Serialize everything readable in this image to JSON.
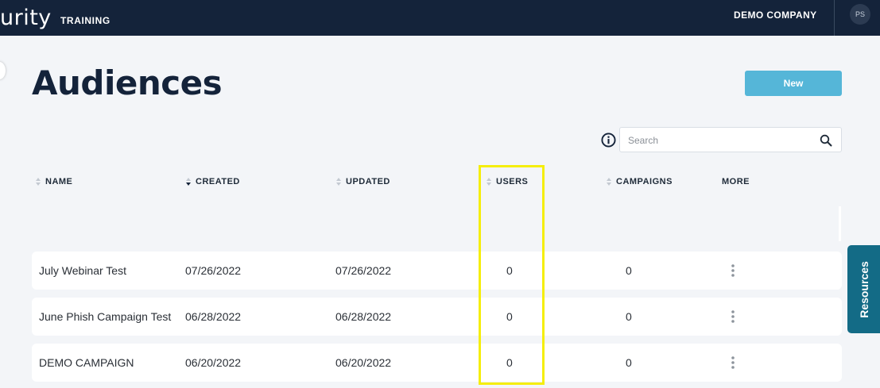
{
  "topbar": {
    "logo_text": "urity",
    "product": "TRAINING",
    "company": "DEMO COMPANY",
    "avatar_initials": "PS"
  },
  "page": {
    "title": "Audiences",
    "new_label": "New"
  },
  "search": {
    "placeholder": "Search",
    "value": ""
  },
  "columns": {
    "name": "NAME",
    "created": "CREATED",
    "updated": "UPDATED",
    "users": "USERS",
    "campaigns": "CAMPAIGNS",
    "more": "MORE"
  },
  "sort": {
    "active_column": "created",
    "direction": "descending"
  },
  "rows": [
    {
      "name": "July Webinar Test",
      "created": "07/26/2022",
      "updated": "07/26/2022",
      "users": "0",
      "campaigns": "0"
    },
    {
      "name": "June Phish Campaign Test",
      "created": "06/28/2022",
      "updated": "06/28/2022",
      "users": "0",
      "campaigns": "0"
    },
    {
      "name": "DEMO CAMPAIGN",
      "created": "06/20/2022",
      "updated": "06/20/2022",
      "users": "0",
      "campaigns": "0"
    }
  ],
  "resources_tab": {
    "label": "Resources"
  },
  "colors": {
    "topbar_bg": "#14233a",
    "page_bg": "#f3f5f8",
    "primary_button": "#55b6d8",
    "resources_tab": "#136b86",
    "highlight": "#f5ee0a"
  }
}
